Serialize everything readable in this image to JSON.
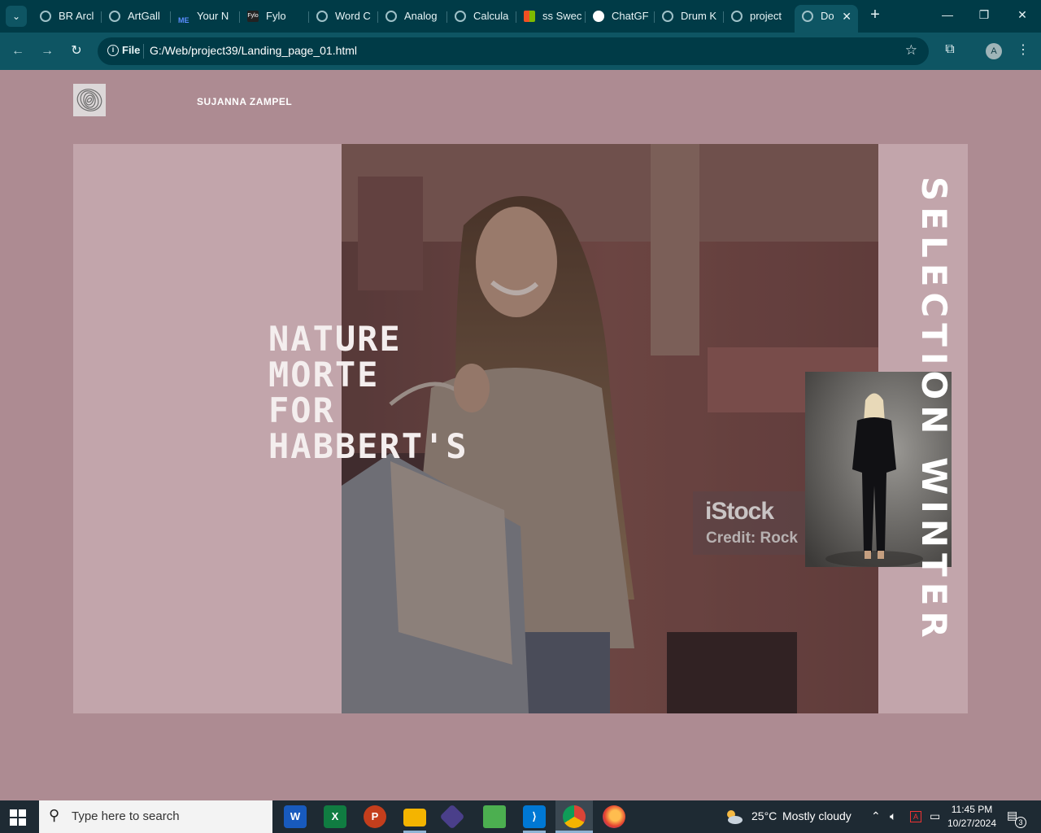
{
  "browser": {
    "tabs": [
      {
        "label": "BR Arcl"
      },
      {
        "label": "ArtGall"
      },
      {
        "label": "Your N"
      },
      {
        "label": "Fylo"
      },
      {
        "label": "Word C"
      },
      {
        "label": "Analog"
      },
      {
        "label": "Calcula"
      },
      {
        "label": "ss Swec"
      },
      {
        "label": "ChatGF"
      },
      {
        "label": "Drum K"
      },
      {
        "label": "project"
      },
      {
        "label": "Do"
      }
    ],
    "address": {
      "scheme_label": "File",
      "url": "G:/Web/project39/Landing_page_01.html"
    },
    "profile_initial": "A"
  },
  "page": {
    "brand": "SUJANNA ZAMPEL",
    "hero_title_lines": [
      "NATURE",
      "MORTE",
      "FOR",
      "HABBERT'S"
    ],
    "vertical_title": "SELECTION WINTER",
    "watermark": {
      "logo": "iStock",
      "credit": "Credit: Rock"
    },
    "colors": {
      "page_bg": "#ad8b92",
      "panel_bg": "#c2a5ab",
      "text": "#ffffff"
    }
  },
  "taskbar": {
    "search_placeholder": "Type here to search",
    "weather": {
      "temp": "25°C",
      "condition": "Mostly cloudy"
    },
    "time": "11:45 PM",
    "date": "10/27/2024",
    "notification_count": "3"
  }
}
